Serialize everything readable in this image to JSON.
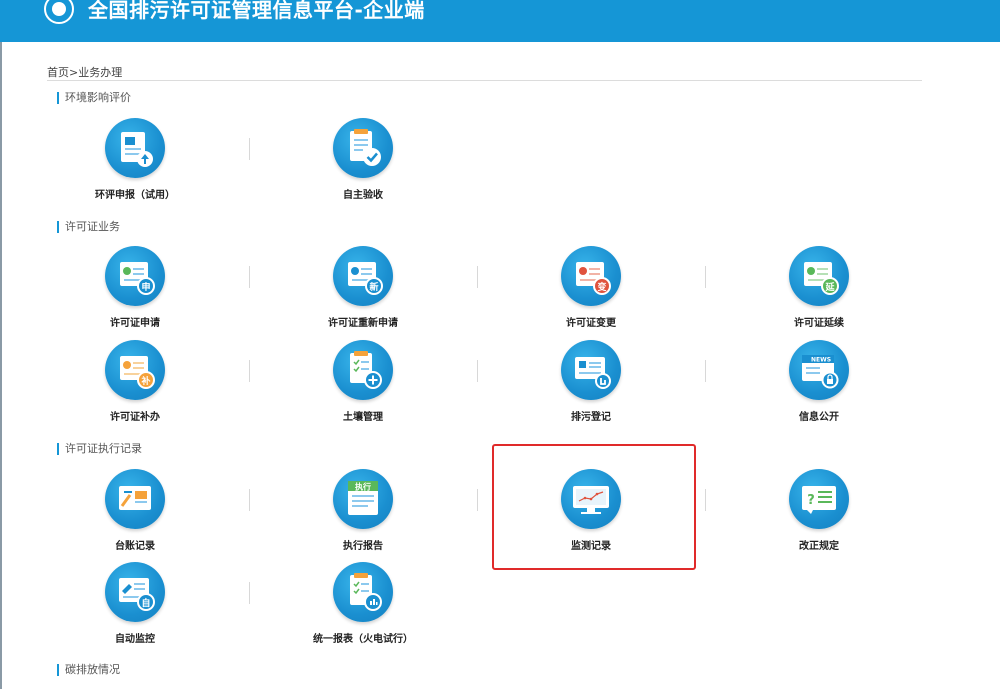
{
  "header": {
    "title": "全国排污许可证管理信息平台-企业端",
    "logo_icon": "emblem-icon",
    "background_color": "#1596d6"
  },
  "breadcrumb": {
    "text": "首页>业务办理"
  },
  "sections": [
    {
      "title": "环境影响评价",
      "items": [
        {
          "label": "环评申报（试用）",
          "icon": "upload-document-icon"
        },
        {
          "label": "自主验收",
          "icon": "checklist-approve-icon"
        }
      ]
    },
    {
      "title": "许可证业务",
      "items": [
        {
          "label": "许可证申请",
          "icon": "certificate-apply-icon",
          "badge": "申"
        },
        {
          "label": "许可证重新申请",
          "icon": "certificate-reapply-icon",
          "badge": "新"
        },
        {
          "label": "许可证变更",
          "icon": "certificate-change-icon",
          "badge": "变"
        },
        {
          "label": "许可证延续",
          "icon": "certificate-extend-icon",
          "badge": "延"
        },
        {
          "label": "许可证补办",
          "icon": "certificate-reissue-icon",
          "badge": "补"
        },
        {
          "label": "土壤管理",
          "icon": "soil-management-icon"
        },
        {
          "label": "排污登记",
          "icon": "discharge-registration-icon"
        },
        {
          "label": "信息公开",
          "icon": "news-disclosure-icon",
          "icon_text": "NEWS"
        }
      ]
    },
    {
      "title": "许可证执行记录",
      "items": [
        {
          "label": "台账记录",
          "icon": "ledger-record-icon"
        },
        {
          "label": "执行报告",
          "icon": "execution-report-icon",
          "icon_text": "执行"
        },
        {
          "label": "监测记录",
          "icon": "monitoring-record-icon",
          "highlighted": true
        },
        {
          "label": "改正规定",
          "icon": "correction-rule-icon",
          "icon_text": "?"
        },
        {
          "label": "自动监控",
          "icon": "auto-monitor-icon",
          "badge": "自"
        },
        {
          "label": "统一报表（火电试行）",
          "icon": "unified-report-icon"
        }
      ]
    },
    {
      "title": "碳排放情况",
      "items": []
    }
  ],
  "colors": {
    "accent": "#1596d6",
    "highlight_border": "#e02a2a",
    "badge_orange": "#f5a23a",
    "badge_red": "#e0533e",
    "badge_green": "#5ab85a"
  }
}
